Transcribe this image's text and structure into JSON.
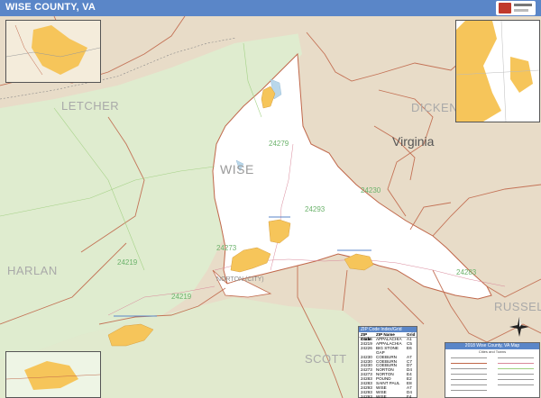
{
  "title": "WISE COUNTY, VA",
  "labels": {
    "letcher": "LETCHER",
    "dickens": "DICKENS",
    "virginia": "Virginia",
    "wise": "WISE",
    "harlan": "HARLAN",
    "russell": "RUSSELL",
    "scott": "SCOTT",
    "zip_24279": "24279",
    "zip_24230": "24230",
    "zip_24283": "24283",
    "zip_24273": "24273",
    "zip_24219": "24219",
    "zip_24219b": "24219",
    "zip_24293": "24293",
    "norton_city": "NORTON (CITY)"
  },
  "zip_table": {
    "title": "ZIP Code Index/Grid Locator",
    "columns": [
      "ZIP Code",
      "ZIP Name",
      "Grid"
    ],
    "rows": [
      [
        "24216",
        "APPALACHIA",
        "A1"
      ],
      [
        "24219",
        "APPALACHIA",
        "C5"
      ],
      [
        "24226",
        "BIG STONE GAP",
        "E6"
      ],
      [
        "24230",
        "COEBURN",
        "A7"
      ],
      [
        "24230",
        "COEBURN",
        "C7"
      ],
      [
        "24230",
        "COEBURN",
        "D7"
      ],
      [
        "24273",
        "NORTON",
        "D4"
      ],
      [
        "24273",
        "NORTON",
        "E4"
      ],
      [
        "24283",
        "POUND",
        "E2"
      ],
      [
        "24283",
        "SAINT PAUL",
        "E8"
      ],
      [
        "24293",
        "WISE",
        "A7"
      ],
      [
        "24293",
        "WISE",
        "D4"
      ],
      [
        "24293",
        "WISE",
        "F4"
      ]
    ]
  },
  "legend": {
    "title": "2018 Wise County, VA Map",
    "subtitle": "Cities and Towns"
  },
  "colors": {
    "title_bar": "#5a86c8",
    "county_fill": "#ffffff",
    "outside_green": "#dfeccf",
    "outside_tan": "#e8dcc8",
    "city_fill": "#f6c55a",
    "boundary": "#c0674a",
    "zip_label": "#6cb36c"
  }
}
